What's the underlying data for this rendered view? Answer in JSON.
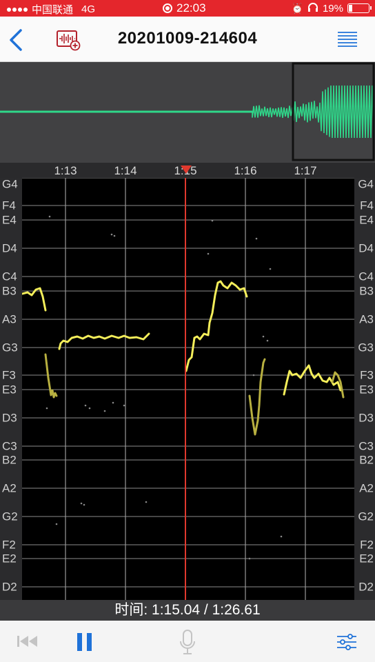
{
  "status_bar": {
    "carrier": "中国联通",
    "network": "4G",
    "time": "22:03",
    "battery_percent": "19%",
    "battery_level": 0.19
  },
  "header": {
    "title": "20201009-214604",
    "back_icon": "chevron-left-icon",
    "add_waveform_icon": "waveform-plus-icon",
    "menu_icon": "list-icon"
  },
  "ruler": {
    "ticks": [
      "1:13",
      "1:14",
      "1:15",
      "1:16",
      "1:17"
    ]
  },
  "pitch_graph": {
    "note_labels": [
      "G4",
      "F4",
      "E4",
      "D4",
      "C4",
      "B3",
      "A3",
      "G3",
      "F3",
      "E3",
      "D3",
      "C3",
      "B2",
      "A2",
      "G2",
      "F2",
      "E2",
      "D2"
    ],
    "playhead_time": "1:15"
  },
  "time_readout": "时间: 1:15.04 / 1:26.61",
  "toolbar": {
    "rewind_icon": "skip-back-icon",
    "pause_icon": "pause-icon",
    "mic_icon": "microphone-icon",
    "settings_icon": "sliders-icon"
  },
  "colors": {
    "status_bar": "#e4262c",
    "accent": "#1f72d8",
    "waveform": "#2fd88a",
    "pitch_line": "#f4ee5a",
    "playhead": "#e0392e"
  }
}
